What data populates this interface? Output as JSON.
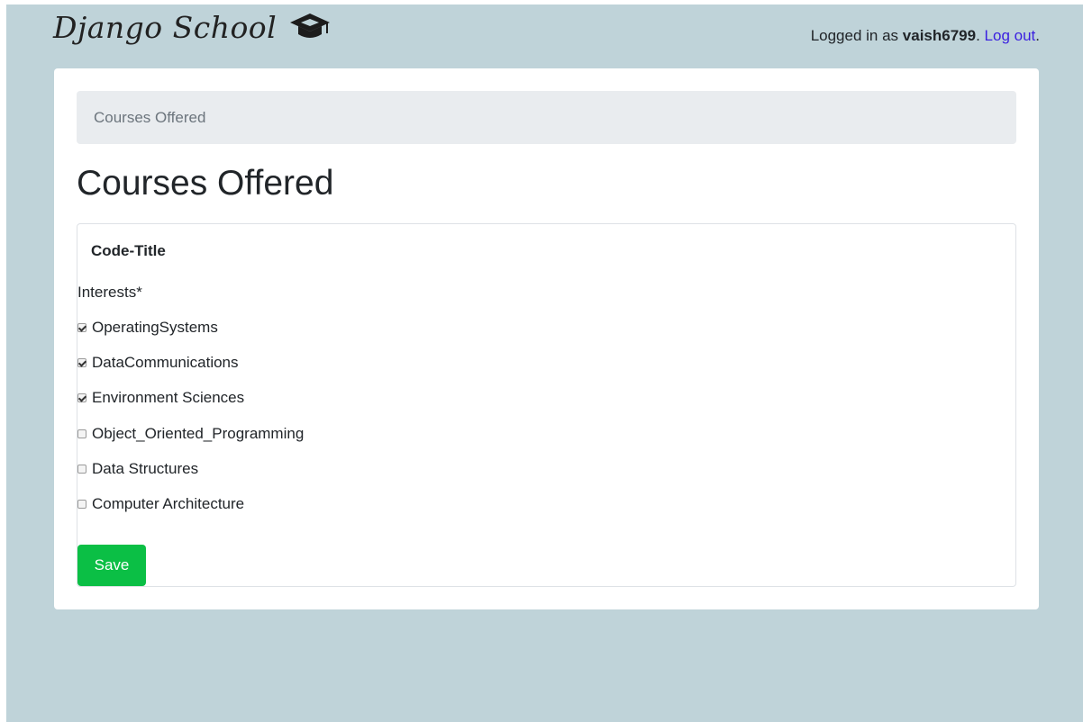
{
  "header": {
    "brand": "Django School",
    "login_prefix": "Logged in as ",
    "username": "vaish6799",
    "separator": ". ",
    "logout_label": "Log out",
    "logout_suffix": "."
  },
  "breadcrumb": {
    "current": "Courses Offered"
  },
  "page": {
    "title": "Courses Offered"
  },
  "form": {
    "card_header": "Code-Title",
    "field_label": "Interests*",
    "options": [
      {
        "label": "OperatingSystems",
        "checked": true
      },
      {
        "label": "DataCommunications",
        "checked": true
      },
      {
        "label": "Environment Sciences",
        "checked": true
      },
      {
        "label": "Object_Oriented_Programming",
        "checked": false
      },
      {
        "label": "Data Structures",
        "checked": false
      },
      {
        "label": "Computer Architecture",
        "checked": false
      }
    ],
    "save_label": "Save"
  },
  "colors": {
    "background": "#bfd3d9",
    "save_button": "#0bbf45",
    "link": "#3a1fe0"
  },
  "icons": {
    "brand_icon": "graduation-cap-icon"
  }
}
